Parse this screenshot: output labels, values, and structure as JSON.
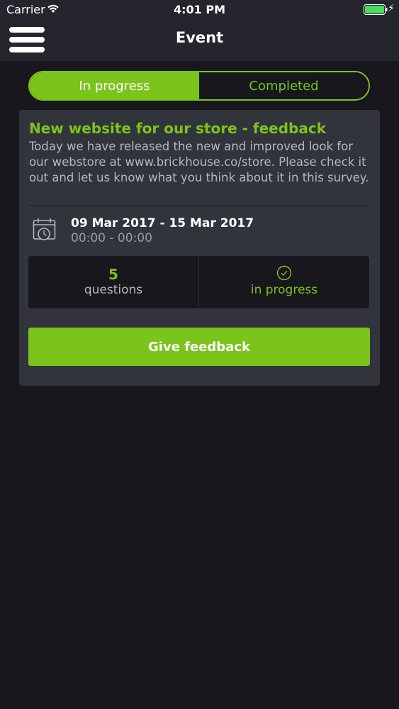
{
  "status_bar": {
    "carrier": "Carrier",
    "time": "4:01 PM",
    "wifi_icon": "wifi-icon",
    "battery_icon": "battery-icon",
    "battery_color": "#4cd964"
  },
  "nav": {
    "title": "Event",
    "menu_icon": "hamburger-menu-icon"
  },
  "tabs": [
    {
      "label": "In progress",
      "active": true
    },
    {
      "label": "Completed",
      "active": false
    }
  ],
  "event": {
    "title": "New website for our store - feedback",
    "description": "Today we have released the new and improved look for our webstore at www.brickhouse.co/store. Please check it out and let us know what you think about it in this survey.",
    "date_range": "09 Mar 2017 - 15 Mar 2017",
    "time_range": "00:00 - 00:00",
    "calendar_icon": "calendar-clock-icon",
    "stats": {
      "questions_count": "5",
      "questions_label": "questions",
      "status_icon": "check-circle-icon",
      "status_label": "in progress"
    },
    "button_label": "Give feedback"
  },
  "colors": {
    "accent": "#7ac41c",
    "background": "#17171d",
    "card": "#32343c",
    "nav": "#25262d"
  }
}
